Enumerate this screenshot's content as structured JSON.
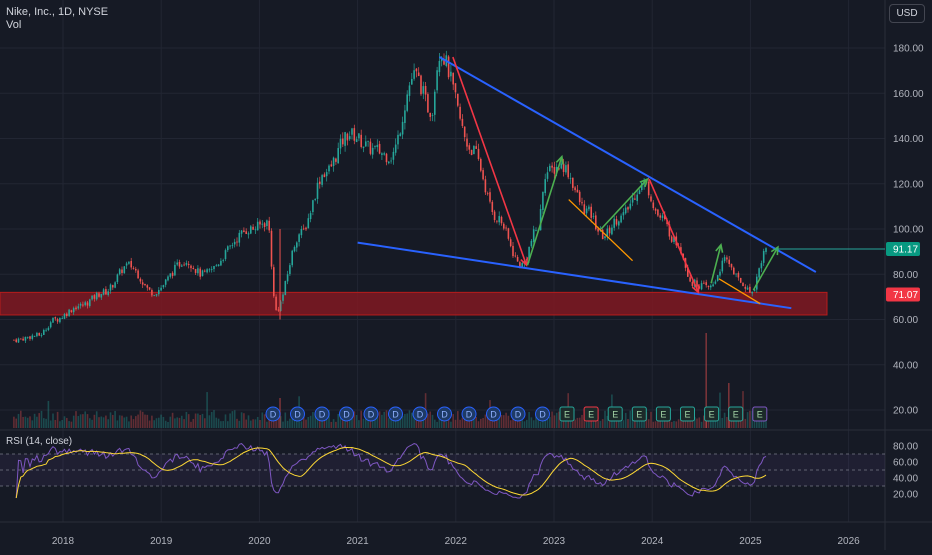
{
  "header": {
    "title": "Nike, Inc., 1D, NYSE",
    "volume_label": "Vol",
    "currency_button": "USD"
  },
  "rsi_panel": {
    "label": "RSI (14, close)",
    "ticks": [
      "80.00",
      "60.00",
      "40.00",
      "20.00"
    ]
  },
  "price_axis": {
    "ticks": [
      "180.00",
      "160.00",
      "140.00",
      "120.00",
      "100.00",
      "80.00",
      "60.00",
      "40.00",
      "20.00"
    ],
    "last_price_label": "91.17",
    "support_label": "71.07"
  },
  "time_axis": {
    "ticks": [
      "2018",
      "2019",
      "2020",
      "2021",
      "2022",
      "2023",
      "2024",
      "2025",
      "2026"
    ]
  },
  "markers": [
    "D",
    "D",
    "D",
    "D",
    "D",
    "D",
    "D",
    "D",
    "D",
    "D",
    "D",
    "D",
    "E",
    "E",
    "E",
    "E",
    "E",
    "E",
    "E",
    "E",
    "E"
  ],
  "colors": {
    "background": "#161a25",
    "up": "#26a69a",
    "down": "#ef5350",
    "trendline": "#2962ff",
    "support_zone": "#801922",
    "arrow_red": "#f23645",
    "arrow_green": "#4caf50",
    "arrow_orange": "#ff9800",
    "rsi_line": "#7e57c2",
    "rsi_ma": "#fdd835",
    "last_price_bg": "#089981",
    "support_label_bg": "#f23645"
  },
  "chart_data": {
    "type": "candlestick",
    "symbol": "Nike, Inc.",
    "interval": "1D",
    "exchange": "NYSE",
    "x_range": [
      "2017-07",
      "2026-05"
    ],
    "y_range": [
      14,
      190
    ],
    "close_path": [
      [
        "2017-07",
        51
      ],
      [
        "2017-10",
        53
      ],
      [
        "2017-12",
        60
      ],
      [
        "2018-03",
        66
      ],
      [
        "2018-06",
        72
      ],
      [
        "2018-09",
        84
      ],
      [
        "2018-12",
        72
      ],
      [
        "2019-04",
        86
      ],
      [
        "2019-06",
        80
      ],
      [
        "2019-12",
        100
      ],
      [
        "2020-02",
        103
      ],
      [
        "2020-03",
        64
      ],
      [
        "2020-06",
        98
      ],
      [
        "2020-09",
        125
      ],
      [
        "2020-12",
        142
      ],
      [
        "2021-03",
        135
      ],
      [
        "2021-05",
        132
      ],
      [
        "2021-08",
        168
      ],
      [
        "2021-10",
        152
      ],
      [
        "2021-11",
        178
      ],
      [
        "2022-03",
        135
      ],
      [
        "2022-06",
        105
      ],
      [
        "2022-09",
        84
      ],
      [
        "2022-11",
        100
      ],
      [
        "2022-12",
        125
      ],
      [
        "2023-02",
        128
      ],
      [
        "2023-05",
        108
      ],
      [
        "2023-07",
        97
      ],
      [
        "2023-09",
        105
      ],
      [
        "2023-12",
        120
      ],
      [
        "2024-02",
        105
      ],
      [
        "2024-04",
        94
      ],
      [
        "2024-06",
        76
      ],
      [
        "2024-08",
        74
      ],
      [
        "2024-10",
        86
      ],
      [
        "2024-12",
        76
      ],
      [
        "2025-01",
        72
      ],
      [
        "2025-03",
        91.17
      ]
    ],
    "last_price": 91.17,
    "support_level": 71.07,
    "support_zone": [
      62,
      72
    ],
    "trendlines": [
      {
        "from": [
          "2021-11",
          176
        ],
        "to": [
          "2025-09",
          81
        ]
      },
      {
        "from": [
          "2021-01",
          94
        ],
        "to": [
          "2025-06",
          65
        ]
      }
    ],
    "rsi": {
      "period": 14,
      "source": "close",
      "bands": [
        70,
        50,
        30
      ],
      "y_range": [
        15,
        85
      ]
    }
  }
}
